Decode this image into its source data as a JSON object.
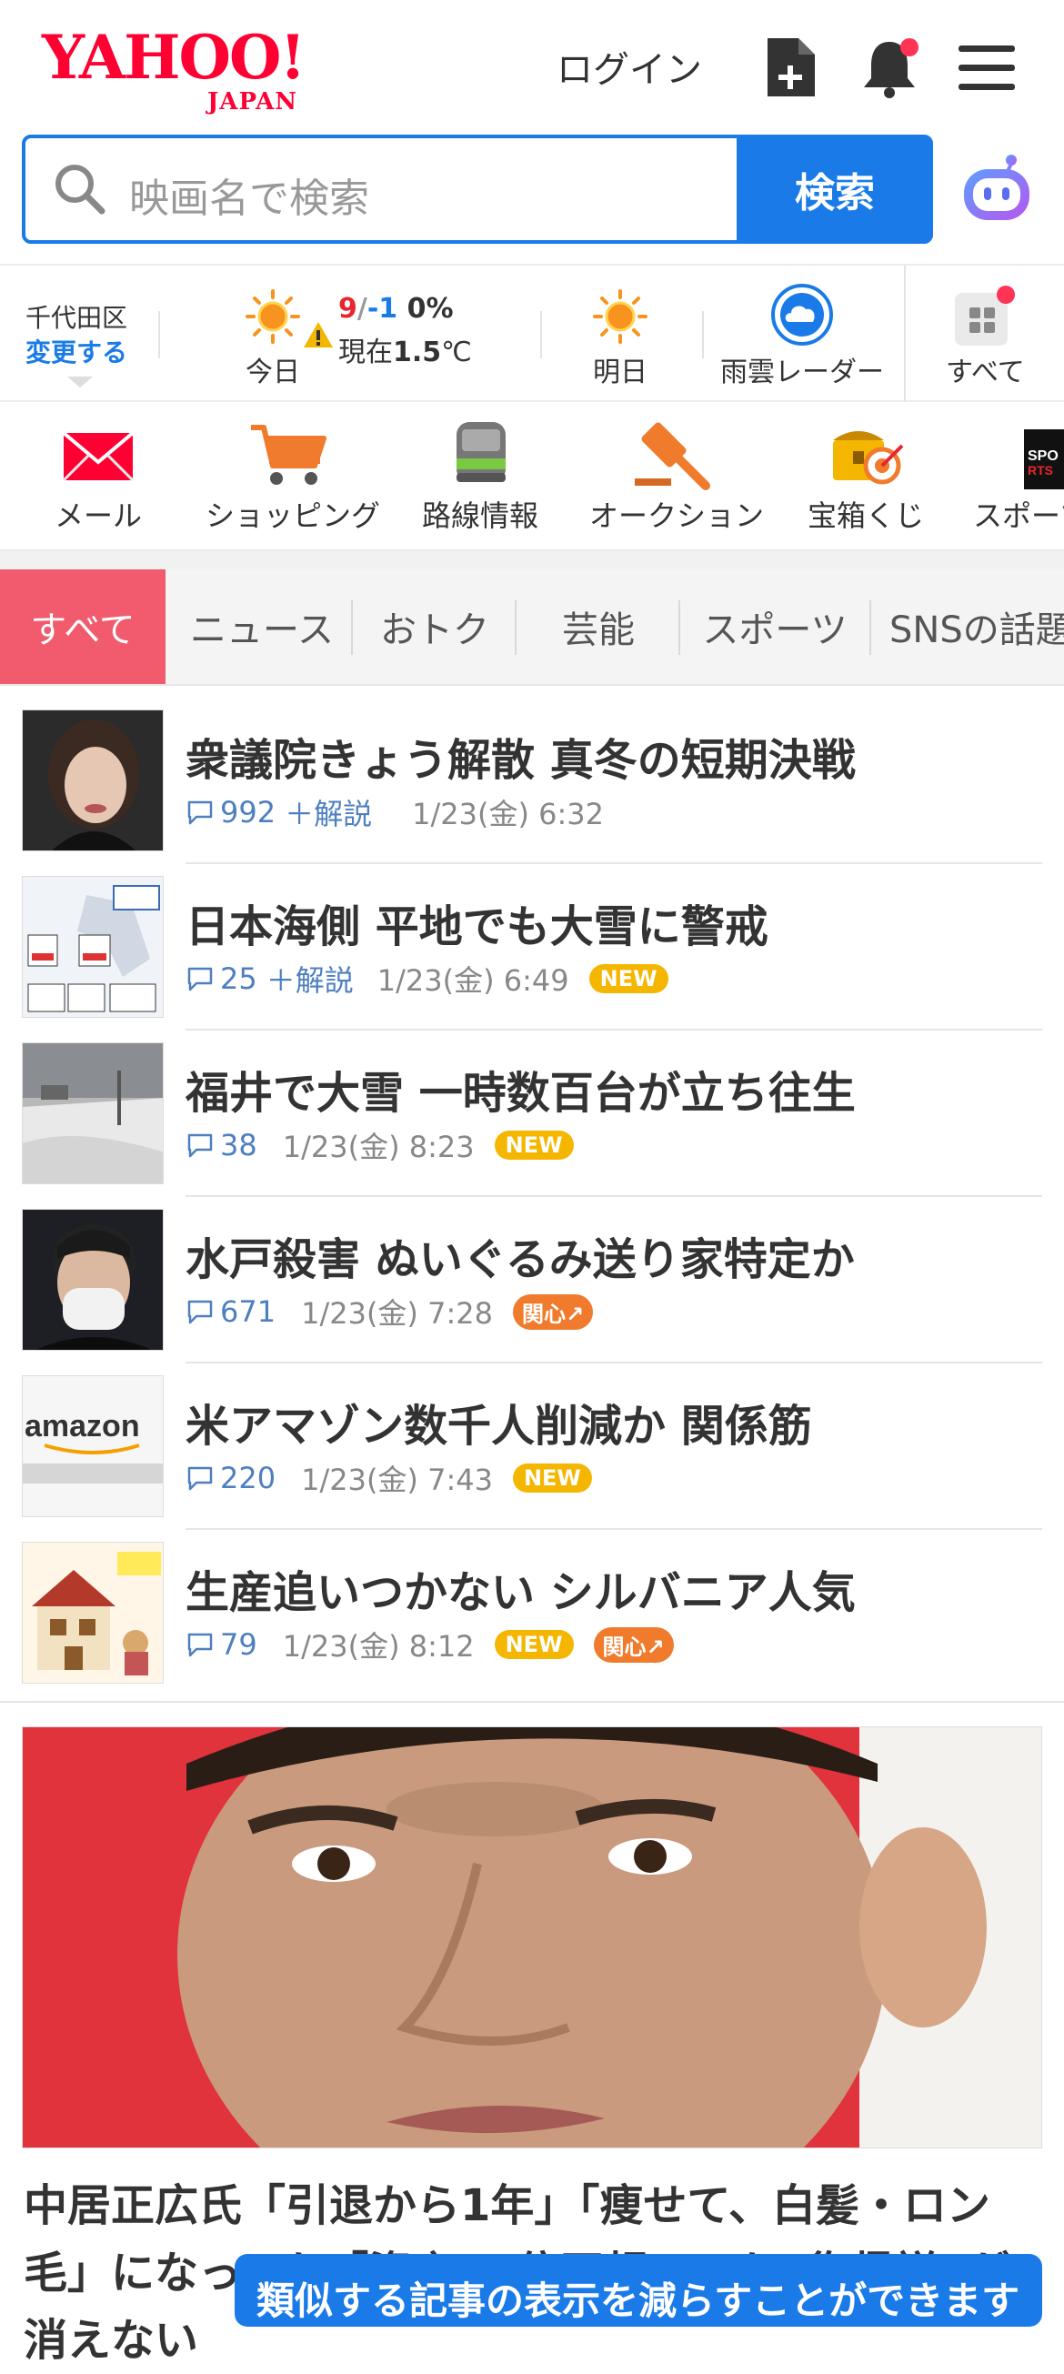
{
  "header": {
    "logo_main": "YAHOO!",
    "logo_sub": "JAPAN",
    "login_label": "ログイン"
  },
  "search": {
    "placeholder": "映画名で検索",
    "button_label": "検索"
  },
  "weather": {
    "location": "千代田区",
    "change_label": "変更する",
    "today_label": "今日",
    "high": "9",
    "slash": "/",
    "low": "-1",
    "precip": "0%",
    "now_prefix": "現在",
    "now_temp": "1.5",
    "now_unit": "℃",
    "tomorrow_label": "明日",
    "radar_label": "雨雲レーダー",
    "all_label": "すべて"
  },
  "services": [
    {
      "label": "メール",
      "icon": "mail-icon"
    },
    {
      "label": "ショッピング",
      "icon": "cart-icon"
    },
    {
      "label": "路線情報",
      "icon": "train-icon"
    },
    {
      "label": "オークション",
      "icon": "auction-icon"
    },
    {
      "label": "宝箱くじ",
      "icon": "treasure-icon"
    },
    {
      "label": "スポーツ",
      "icon": "sports-icon"
    }
  ],
  "tabs": [
    "すべて",
    "ニュース",
    "おトク",
    "芸能",
    "スポーツ",
    "SNSの話題"
  ],
  "news": [
    {
      "title": "衆議院きょう解散 真冬の短期決戦",
      "comments": "992",
      "explain": "＋解説",
      "time": "1/23(金) 6:32",
      "badges": []
    },
    {
      "title": "日本海側 平地でも大雪に警戒",
      "comments": "25",
      "explain": "＋解説",
      "time": "1/23(金) 6:49",
      "badges": [
        "NEW"
      ]
    },
    {
      "title": "福井で大雪 一時数百台が立ち往生",
      "comments": "38",
      "explain": "",
      "time": "1/23(金) 8:23",
      "badges": [
        "NEW"
      ]
    },
    {
      "title": "水戸殺害 ぬいぐるみ送り家特定か",
      "comments": "671",
      "explain": "",
      "time": "1/23(金) 7:28",
      "badges": [
        "関心↗"
      ]
    },
    {
      "title": "米アマゾン数千人削減か 関係筋",
      "comments": "220",
      "explain": "",
      "time": "1/23(金) 7:43",
      "badges": [
        "NEW"
      ]
    },
    {
      "title": "生産追いつかない シルバニア人気",
      "comments": "79",
      "explain": "",
      "time": "1/23(金) 8:12",
      "badges": [
        "NEW",
        "関心↗"
      ]
    }
  ],
  "thumb_text": {
    "amazon": "amazon"
  },
  "feature": {
    "title": "中居正広氏「引退から1年」「痩せて、白髪・ロン毛」になっても「資産20億円超」でも“復帰説”が消えない"
  },
  "toast": "類似する記事の表示を減らすことができます",
  "colors": {
    "brand_red": "#ff0033",
    "accent_blue": "#1a7be8",
    "tab_active": "#f25a6d",
    "new_badge": "#f5b600",
    "hot_badge": "#f07b2c"
  }
}
